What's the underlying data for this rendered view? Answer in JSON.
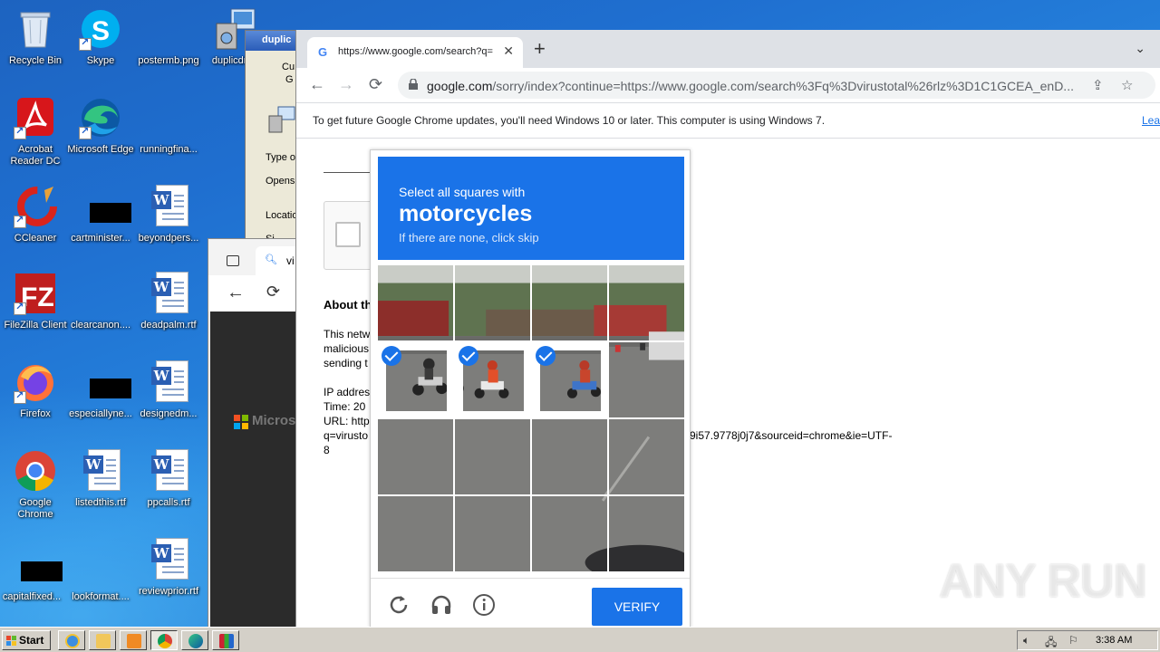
{
  "desktop": {
    "icons": [
      {
        "label": "Recycle Bin",
        "icon": "recycle-bin-icon"
      },
      {
        "label": "Skype",
        "icon": "skype-icon"
      },
      {
        "label": "postermb.png",
        "icon": "image-file-icon"
      },
      {
        "label": "duplicdri...",
        "icon": "installer-icon"
      },
      {
        "label": "Acrobat Reader DC",
        "icon": "acrobat-icon"
      },
      {
        "label": "Microsoft Edge",
        "icon": "edge-icon"
      },
      {
        "label": "runningfina...",
        "icon": "file-icon"
      },
      {
        "label": "CCleaner",
        "icon": "ccleaner-icon"
      },
      {
        "label": "cartminister...",
        "icon": "file-icon"
      },
      {
        "label": "beyondpers...",
        "icon": "word-doc-icon"
      },
      {
        "label": "FileZilla Client",
        "icon": "filezilla-icon"
      },
      {
        "label": "clearcanon....",
        "icon": "file-icon"
      },
      {
        "label": "deadpalm.rtf",
        "icon": "word-doc-icon"
      },
      {
        "label": "Firefox",
        "icon": "firefox-icon"
      },
      {
        "label": "especiallyne...",
        "icon": "file-icon"
      },
      {
        "label": "designedm...",
        "icon": "word-doc-icon"
      },
      {
        "label": "Google Chrome",
        "icon": "chrome-icon"
      },
      {
        "label": "listedthis.rtf",
        "icon": "word-doc-icon"
      },
      {
        "label": "ppcalls.rtf",
        "icon": "word-doc-icon"
      },
      {
        "label": "capitalfixed...",
        "icon": "file-icon"
      },
      {
        "label": "lookformat....",
        "icon": "file-icon"
      },
      {
        "label": "reviewprior.rtf",
        "icon": "word-doc-icon"
      }
    ]
  },
  "dup_window": {
    "title": "duplic",
    "rows": [
      "Cu",
      "G",
      "Type o",
      "Opens",
      "Locatio",
      "Si"
    ]
  },
  "edge_window": {
    "tab_text": "vi",
    "brand": "Microso"
  },
  "chrome": {
    "tab_title": "https://www.google.com/search?q=",
    "url_host": "google.com",
    "url_rest": "/sorry/index?continue=https://www.google.com/search%3Fq%3Dvirustotal%26rlz%3D1C1GCEA_enD...",
    "infobar_message": "To get future Google Chrome updates, you'll need Windows 10 or later. This computer is using Windows 7.",
    "infobar_link": "Learn more"
  },
  "page": {
    "about_heading": "About th",
    "para_lines": [
      "This netw",
      "malicious",
      "sending t"
    ],
    "ip_label": "IP addres",
    "time_label": "Time: 20",
    "url_label": "URL: http",
    "url_line2_left": "q=virusto",
    "url_line2_right": "9i57.9778j0j7&sourceid=chrome&ie=UTF-",
    "url_line3": "8"
  },
  "captcha": {
    "instruction": "Select all squares with",
    "target": "motorcycles",
    "hint": "If there are none, click skip",
    "verify_label": "VERIFY",
    "selected_tiles": [
      4,
      5,
      6
    ]
  },
  "taskbar": {
    "start_label": "Start",
    "clock": "3:38 AM"
  },
  "watermark": "ANY RUN"
}
